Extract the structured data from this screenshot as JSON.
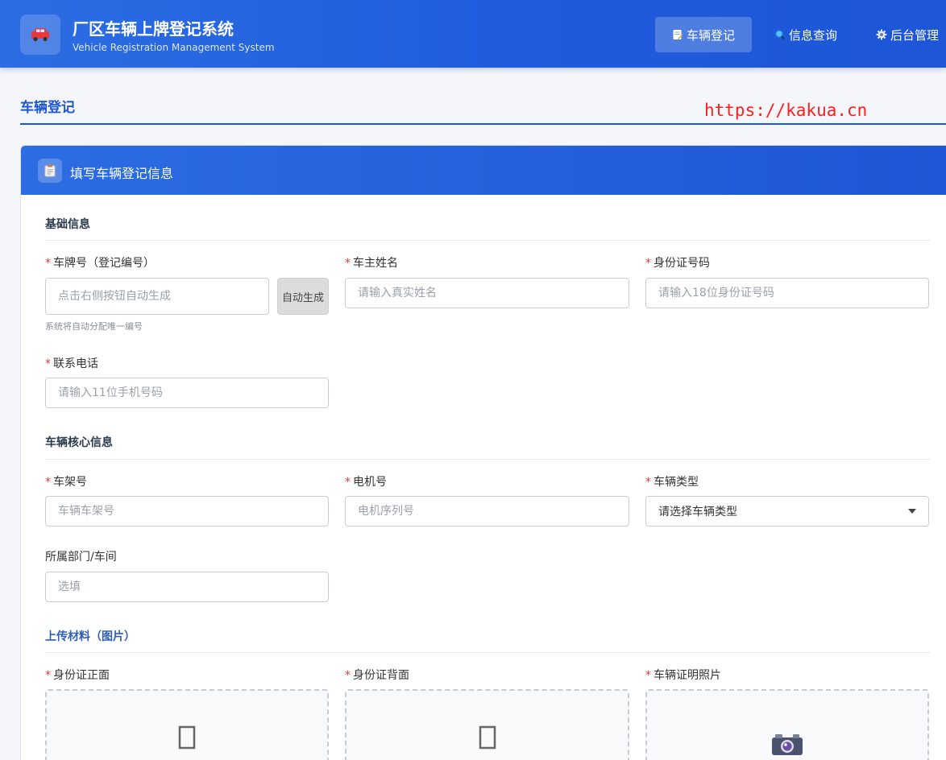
{
  "header": {
    "title": "厂区车辆上牌登记系统",
    "subtitle": "Vehicle Registration Management System",
    "logo_icon": "car-icon",
    "nav": [
      {
        "label": "车辆登记",
        "icon": "edit-doc-icon",
        "active": true
      },
      {
        "label": "信息查询",
        "icon": "search-icon",
        "active": false
      },
      {
        "label": "后台管理",
        "icon": "gear-icon",
        "active": false
      }
    ]
  },
  "page": {
    "title": "车辆登记",
    "watermark": "https://kakua.cn"
  },
  "card": {
    "title": "填写车辆登记信息",
    "icon": "clipboard-icon"
  },
  "sections": {
    "basic": {
      "title": "基础信息",
      "plate": {
        "label": "车牌号（登记编号）",
        "placeholder": "点击右侧按钮自动生成",
        "button": "自动生成",
        "hint": "系统将自动分配唯一编号"
      },
      "owner": {
        "label": "车主姓名",
        "placeholder": "请输入真实姓名"
      },
      "idcard": {
        "label": "身份证号码",
        "placeholder": "请输入18位身份证号码"
      },
      "phone": {
        "label": "联系电话",
        "placeholder": "请输入11位手机号码"
      }
    },
    "core": {
      "title": "车辆核心信息",
      "frame": {
        "label": "车架号",
        "placeholder": "车辆车架号"
      },
      "motor": {
        "label": "电机号",
        "placeholder": "电机序列号"
      },
      "type": {
        "label": "车辆类型",
        "selected": "请选择车辆类型"
      },
      "dept": {
        "label": "所属部门/车间",
        "placeholder": "选填"
      }
    },
    "upload": {
      "title": "上传材料（图片）",
      "id_front": {
        "label": "身份证正面",
        "icon": "image-placeholder-icon"
      },
      "id_back": {
        "label": "身份证背面",
        "icon": "image-placeholder-icon"
      },
      "vehicle_photo": {
        "label": "车辆证明照片",
        "icon": "camera-icon"
      }
    }
  },
  "required_mark": "*",
  "colors": {
    "primary": "#1d56d6",
    "required": "#e53935",
    "watermark": "#ff1e1e"
  }
}
